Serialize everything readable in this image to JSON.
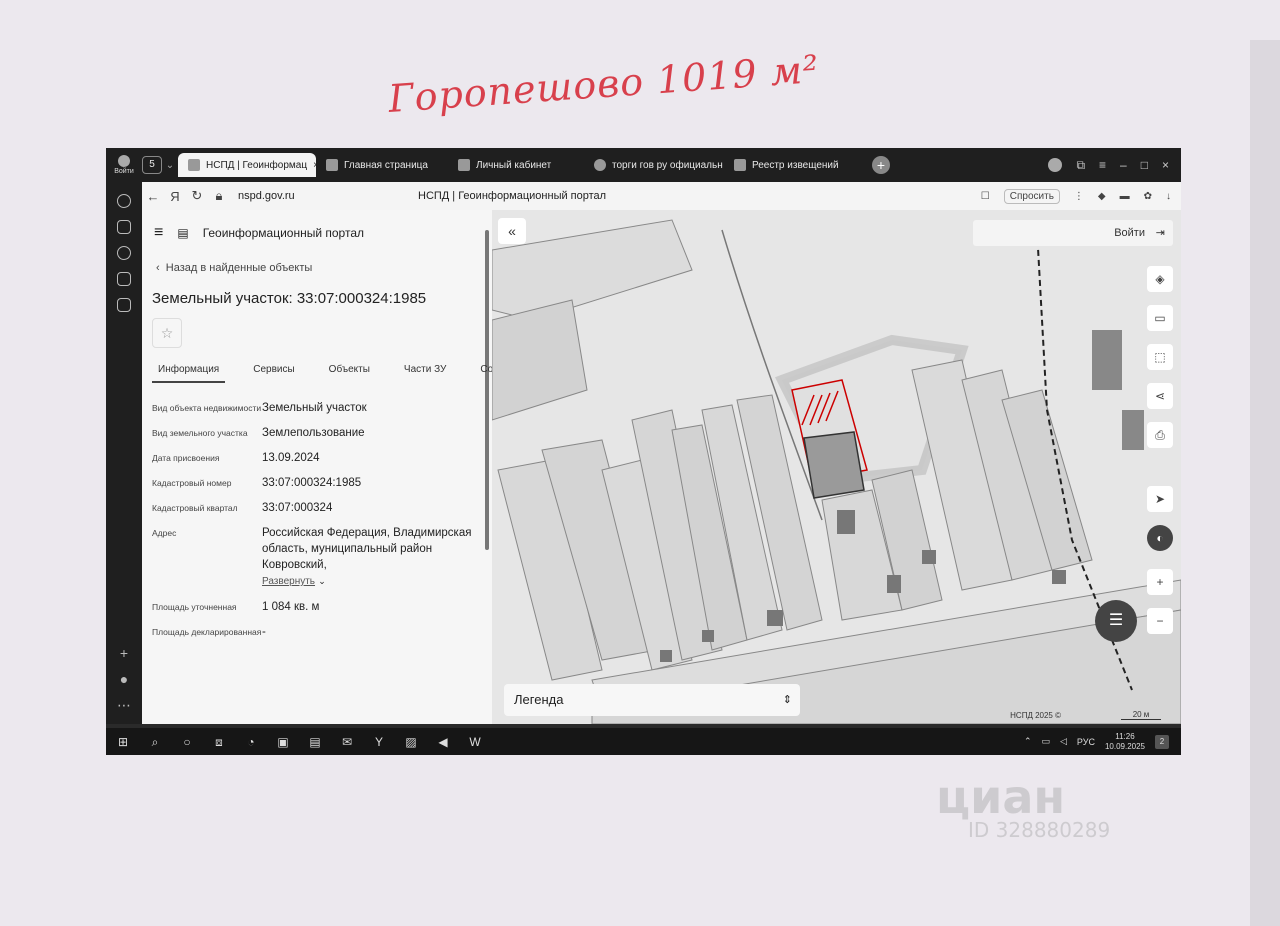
{
  "handwriting": "Горопешово 1019 м²",
  "watermark": {
    "logo": "циан",
    "id": "ID 328880289"
  },
  "browser": {
    "login_label": "Войти",
    "tab_count": "5",
    "tabs": [
      {
        "label": "НСПД | Геоинформац",
        "active": true
      },
      {
        "label": "Главная страница"
      },
      {
        "label": "Личный кабинет"
      },
      {
        "label": "торги гов ру официальн"
      },
      {
        "label": "Реестр извещений"
      }
    ],
    "address": {
      "url": "nspd.gov.ru",
      "page_title": "НСПД | Геоинформационный портал",
      "ask_label": "Спросить"
    }
  },
  "panel": {
    "portal_title": "Геоинформационный портал",
    "back_label": "Назад в найденные объекты",
    "parcel_title": "Земельный участок: 33:07:000324:1985",
    "tabs": [
      "Информация",
      "Сервисы",
      "Объекты",
      "Части ЗУ",
      "Соста"
    ],
    "rows": [
      {
        "key": "Вид объекта недвижимости",
        "value": "Земельный участок"
      },
      {
        "key": "Вид земельного участка",
        "value": "Землепользование"
      },
      {
        "key": "Дата присвоения",
        "value": "13.09.2024"
      },
      {
        "key": "Кадастровый номер",
        "value": "33:07:000324:1985"
      },
      {
        "key": "Кадастровый квартал",
        "value": "33:07:000324"
      },
      {
        "key": "Адрес",
        "value": "Российская Федерация, Владимирская область, муниципальный район Ковровский,"
      },
      {
        "key": "Площадь уточненная",
        "value": "1 084 кв. м"
      },
      {
        "key": "Площадь декларированная",
        "value": "-"
      }
    ],
    "expand_label": "Развернуть"
  },
  "map": {
    "login_label": "Войти",
    "legend_label": "Легенда",
    "copyright": "НСПД 2025 ©",
    "scale": "20 м"
  },
  "taskbar": {
    "lang": "РУС",
    "time": "11:26",
    "date": "10.09.2025",
    "notifications": "2"
  }
}
